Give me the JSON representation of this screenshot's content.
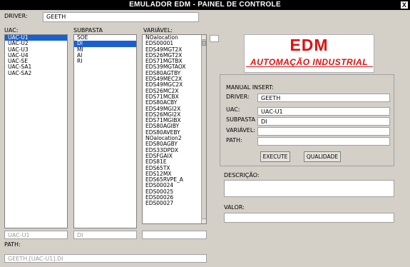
{
  "window": {
    "title": "EMULADOR EDM - PAINEL DE CONTROLE",
    "close_label": "X"
  },
  "driver": {
    "label": "DRIVER:",
    "value": "GEETH"
  },
  "uac": {
    "label": "UAC:",
    "items": [
      "UAC-U1",
      "UAC-U2",
      "UAC-U3",
      "UAC-U4",
      "UAC-SE",
      "UAC-SA1",
      "UAC-SA2"
    ],
    "selected_index": 0,
    "selected_value": "UAC-U1"
  },
  "subpasta": {
    "label": "SUBPASTA",
    "items": [
      "SOE",
      "DI",
      "MI",
      "AI",
      "RI"
    ],
    "selected_index": 1,
    "selected_value": "DI"
  },
  "variavel": {
    "label": "VARIÁVEL:",
    "items": [
      "NOalocation",
      "EDS00001",
      "EDS49MGT2X",
      "EDS26MGT2X",
      "EDS71MGTBX",
      "EDS39MGTAOX",
      "EDS80AGTBY",
      "EDS49MEC2X",
      "EDS49MGC2X",
      "EDS26MC2X",
      "EDS71MCBX",
      "EDS80ACBY",
      "EDS49MGI2X",
      "EDS26MGI2X",
      "EDS71MGIBX",
      "EDS80AGIBY",
      "EDS80AVEBY",
      "NOalocation2",
      "EDS80AGBY",
      "EDS33DPDX",
      "EDSFGAIX",
      "EDS81E",
      "EDS65TX",
      "EDS12MX",
      "EDS65RVPE_A",
      "EDS00024",
      "EDS00025",
      "EDS00026",
      "EDS00027"
    ],
    "selected_value": ""
  },
  "path": {
    "label": "PATH:",
    "value": "GEETH.[UAC-U1].DI"
  },
  "logo": {
    "top_text": "EDM",
    "bottom_text": "AUTOMAÇÃO INDUSTRIAL"
  },
  "manual_insert": {
    "title": "MANUAL INSERT:",
    "driver_label": "DRIVER:",
    "driver_value": "GEETH",
    "uac_label": "UAC:",
    "uac_value": "UAC-U1",
    "subpasta_label": "SUBPASTA",
    "subpasta_value": "DI",
    "variavel_label": "VARIÁVEL:",
    "variavel_value": "",
    "path_label": "PATH:",
    "path_value": "",
    "execute_label": "EXECUTE",
    "qualidade_label": "QUALIDADE"
  },
  "descricao": {
    "label": "DESCRIÇÃO:",
    "value": ""
  },
  "valor": {
    "label": "VALOR:",
    "value": ""
  },
  "colors": {
    "titlebar": "#000000",
    "selection": "#1a5fd1",
    "logo": "#e01010",
    "background": "#d4d0c8"
  }
}
